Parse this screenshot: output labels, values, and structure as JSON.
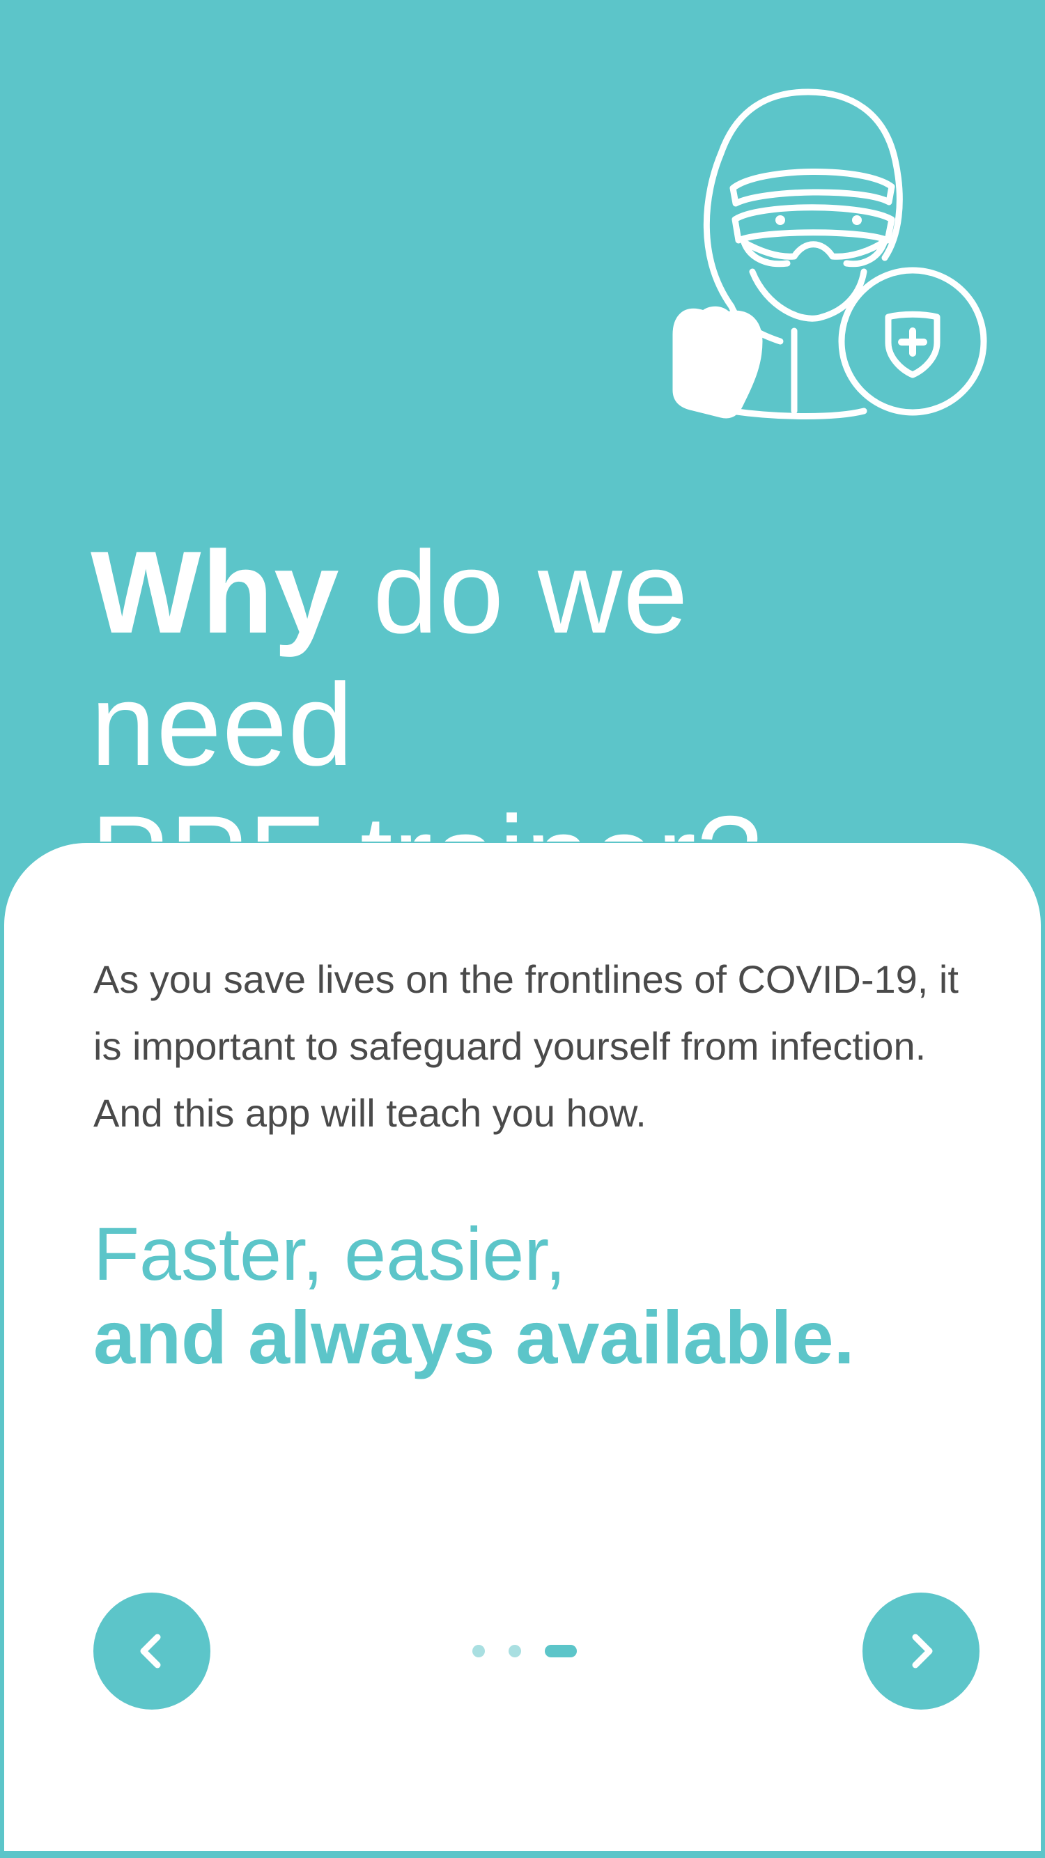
{
  "hero": {
    "headline_bold": "Why",
    "headline_rest": " do we need",
    "headline_line2": "PPE trainer?",
    "illustration_icon": "ppe-health-worker-icon"
  },
  "card": {
    "body": "As you save lives on the frontlines of COVID-19, it is important to safeguard yourself from infection. And this app will teach you how.",
    "tagline_line1": "Faster, easier,",
    "tagline_line2": "and always available."
  },
  "navigation": {
    "prev_icon": "chevron-left-icon",
    "next_icon": "chevron-right-icon",
    "pages": 3,
    "current_page": 3
  },
  "colors": {
    "accent": "#5cc5c9",
    "dot_inactive": "#a9dfe1",
    "text": "#4a4a4a",
    "background": "#ffffff"
  }
}
